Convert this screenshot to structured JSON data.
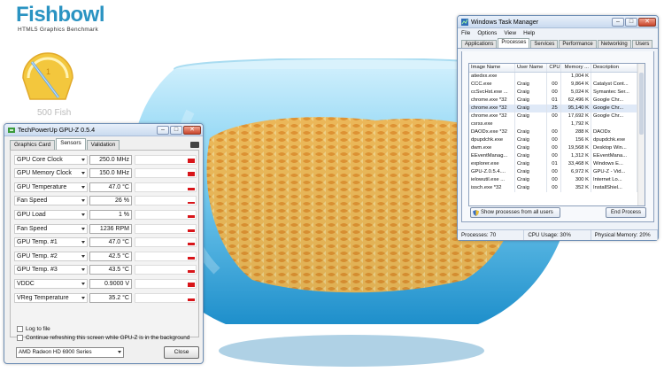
{
  "brand": {
    "title": "Fishbowl",
    "subtitle": "HTML5 Graphics Benchmark",
    "fish_count": "500 Fish"
  },
  "gpuz": {
    "title": "TechPowerUp GPU-Z 0.5.4",
    "tabs": [
      "Graphics Card",
      "Sensors",
      "Validation"
    ],
    "active_tab": "Sensors",
    "sensors": [
      {
        "name": "GPU Core Clock",
        "value": "250.0 MHz",
        "level": 0.5
      },
      {
        "name": "GPU Memory Clock",
        "value": "150.0 MHz",
        "level": 0.5
      },
      {
        "name": "GPU Temperature",
        "value": "47.0 °C",
        "level": 0.35
      },
      {
        "name": "Fan Speed",
        "value": "26 %",
        "level": 0.25
      },
      {
        "name": "GPU Load",
        "value": "1 %",
        "level": 0.3
      },
      {
        "name": "Fan Speed",
        "value": "1236 RPM",
        "level": 0.35
      },
      {
        "name": "GPU Temp. #1",
        "value": "47.0 °C",
        "level": 0.35
      },
      {
        "name": "GPU Temp. #2",
        "value": "42.5 °C",
        "level": 0.35
      },
      {
        "name": "GPU Temp. #3",
        "value": "43.5 °C",
        "level": 0.35
      },
      {
        "name": "VDDC",
        "value": "0.9000 V",
        "level": 0.6
      },
      {
        "name": "VReg Temperature",
        "value": "35.2 °C",
        "level": 0.35
      }
    ],
    "log_to_file": "Log to file",
    "continue_refresh": "Continue refreshing this screen while GPU-Z is in the background",
    "selected_card": "AMD Radeon HD 6900 Series",
    "close_label": "Close"
  },
  "taskmgr": {
    "title": "Windows Task Manager",
    "menu": [
      "File",
      "Options",
      "View",
      "Help"
    ],
    "tabs": [
      "Applications",
      "Processes",
      "Services",
      "Performance",
      "Networking",
      "Users"
    ],
    "active_tab": "Processes",
    "columns": [
      "Image Name",
      "User Name",
      "CPU",
      "Memory ...",
      "Description"
    ],
    "rows": [
      [
        "atiedxx.exe",
        "",
        "",
        "1,004 K",
        ""
      ],
      [
        "CCC.exe",
        "Craig",
        "00",
        "9,864 K",
        "Catalyst Cont..."
      ],
      [
        "ccSvcHst.exe ...",
        "Craig",
        "00",
        "5,024 K",
        "Symantec Ser..."
      ],
      [
        "chrome.exe *32",
        "Craig",
        "01",
        "62,496 K",
        "Google Chr..."
      ],
      [
        "chrome.exe *32",
        "Craig",
        "25",
        "95,140 K",
        "Google Chr..."
      ],
      [
        "chrome.exe *32",
        "Craig",
        "00",
        "17,692 K",
        "Google Chr..."
      ],
      [
        "csrss.exe",
        "",
        "",
        "1,792 K",
        ""
      ],
      [
        "DAODx.exe *32",
        "Craig",
        "00",
        "288 K",
        "DAODx"
      ],
      [
        "dpupdchk.exe",
        "Craig",
        "00",
        "156 K",
        "dpupdchk.exe"
      ],
      [
        "dwm.exe",
        "Craig",
        "00",
        "19,568 K",
        "Desktop Win..."
      ],
      [
        "EEventManag...",
        "Craig",
        "00",
        "1,312 K",
        "EEventMana..."
      ],
      [
        "explorer.exe",
        "Craig",
        "01",
        "33,468 K",
        "Windows E..."
      ],
      [
        "GPU-Z.0.5.4....",
        "Craig",
        "00",
        "6,972 K",
        "GPU-Z - Vid..."
      ],
      [
        "ielowutil.exe ...",
        "Craig",
        "00",
        "300 K",
        "Internet Lo..."
      ],
      [
        "issch.exe *32",
        "Craig",
        "00",
        "352 K",
        "InstallShiel..."
      ]
    ],
    "selected_row": 4,
    "show_all_label": "Show processes from all users",
    "end_process_label": "End Process",
    "status": {
      "processes": "Processes: 70",
      "cpu": "CPU Usage: 30%",
      "memory": "Physical Memory: 20%"
    }
  }
}
